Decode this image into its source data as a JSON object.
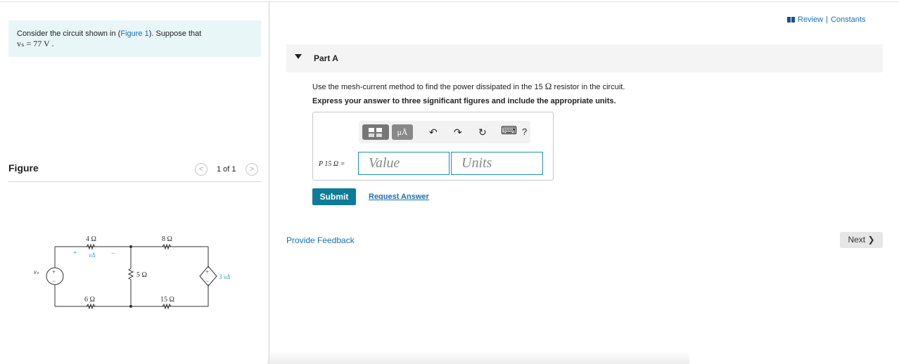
{
  "problem": {
    "text_before": "Consider the circuit shown in (",
    "figure_link": "Figure 1",
    "text_after": "). Suppose that",
    "given": "vₛ = 77  V ."
  },
  "figure": {
    "title": "Figure",
    "pager": {
      "prev": "<",
      "count": "1 of 1",
      "next": ">"
    },
    "circuit_labels": {
      "r4": "4 Ω",
      "r8": "8 Ω",
      "r5": "5 Ω",
      "r6": "6 Ω",
      "r15": "15 Ω",
      "vdelta": "vΔ",
      "plus": "+",
      "minus": "−",
      "vs": "vₛ",
      "dep_src": "3 vΔ",
      "src_plus": "+",
      "src_minus": "−"
    }
  },
  "header": {
    "review": "Review",
    "separator": " | ",
    "constants": "Constants"
  },
  "part": {
    "title": "Part A",
    "instruction_before": "Use the mesh-current method to find the power dissipated in the 15 ",
    "ohm": "Ω",
    "instruction_after": " resistor in the circuit.",
    "express": "Express your answer to three significant figures and include the appropriate units."
  },
  "toolbar": {
    "mu_label": "μÅ",
    "undo": "↶",
    "redo": "↷",
    "reset": "↻",
    "keyboard": "⌨",
    "help": "?"
  },
  "answer": {
    "label": "P 15 Ω =",
    "value_placeholder": "Value",
    "units_placeholder": "Units"
  },
  "actions": {
    "submit": "Submit",
    "request": "Request Answer",
    "feedback": "Provide Feedback",
    "next": "Next ❯"
  }
}
